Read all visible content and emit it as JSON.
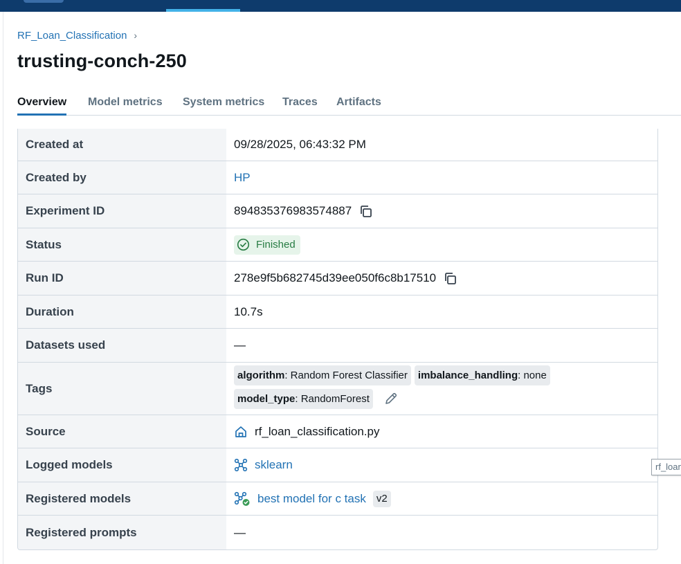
{
  "breadcrumb": {
    "experiment": "RF_Loan_Classification",
    "separator": "›"
  },
  "run": {
    "title": "trusting-conch-250"
  },
  "tabs": [
    {
      "label": "Overview",
      "active": true
    },
    {
      "label": "Model metrics",
      "active": false
    },
    {
      "label": "System metrics",
      "active": false
    },
    {
      "label": "Traces",
      "active": false
    },
    {
      "label": "Artifacts",
      "active": false
    }
  ],
  "details": {
    "created_at": {
      "label": "Created at",
      "value": "09/28/2025, 06:43:32 PM"
    },
    "created_by": {
      "label": "Created by",
      "value": "HP"
    },
    "experiment_id": {
      "label": "Experiment ID",
      "value": "894835376983574887",
      "icon": "copy-icon"
    },
    "status": {
      "label": "Status",
      "value": "Finished",
      "icon": "check-circle-icon",
      "color": "#277c43"
    },
    "run_id": {
      "label": "Run ID",
      "value": "278e9f5b682745d39ee050f6c8b17510",
      "icon": "copy-icon"
    },
    "duration": {
      "label": "Duration",
      "value": "10.7s"
    },
    "datasets_used": {
      "label": "Datasets used",
      "value": "—"
    },
    "tags": {
      "label": "Tags",
      "items": [
        {
          "key": "algorithm",
          "value": ": Random Forest Classifier"
        },
        {
          "key": "imbalance_handling",
          "value": ": none"
        },
        {
          "key": "model_type",
          "value": ": RandomForest"
        }
      ],
      "icon": "pencil-icon"
    },
    "source": {
      "label": "Source",
      "value": "rf_loan_classification.py",
      "icon": "git-home-icon"
    },
    "logged_models": {
      "label": "Logged models",
      "value": "sklearn",
      "icon": "model-icon"
    },
    "registered_models": {
      "label": "Registered models",
      "value": "best model for c task",
      "version": "v2",
      "icon": "registered-model-icon"
    },
    "registered_prompts": {
      "label": "Registered prompts",
      "value": "—"
    }
  },
  "tooltip": {
    "text": "rf_loan_classification.py"
  },
  "colors": {
    "nav": "#0e3b6c",
    "link": "#2272b4",
    "active_tab": "#2272b4"
  }
}
